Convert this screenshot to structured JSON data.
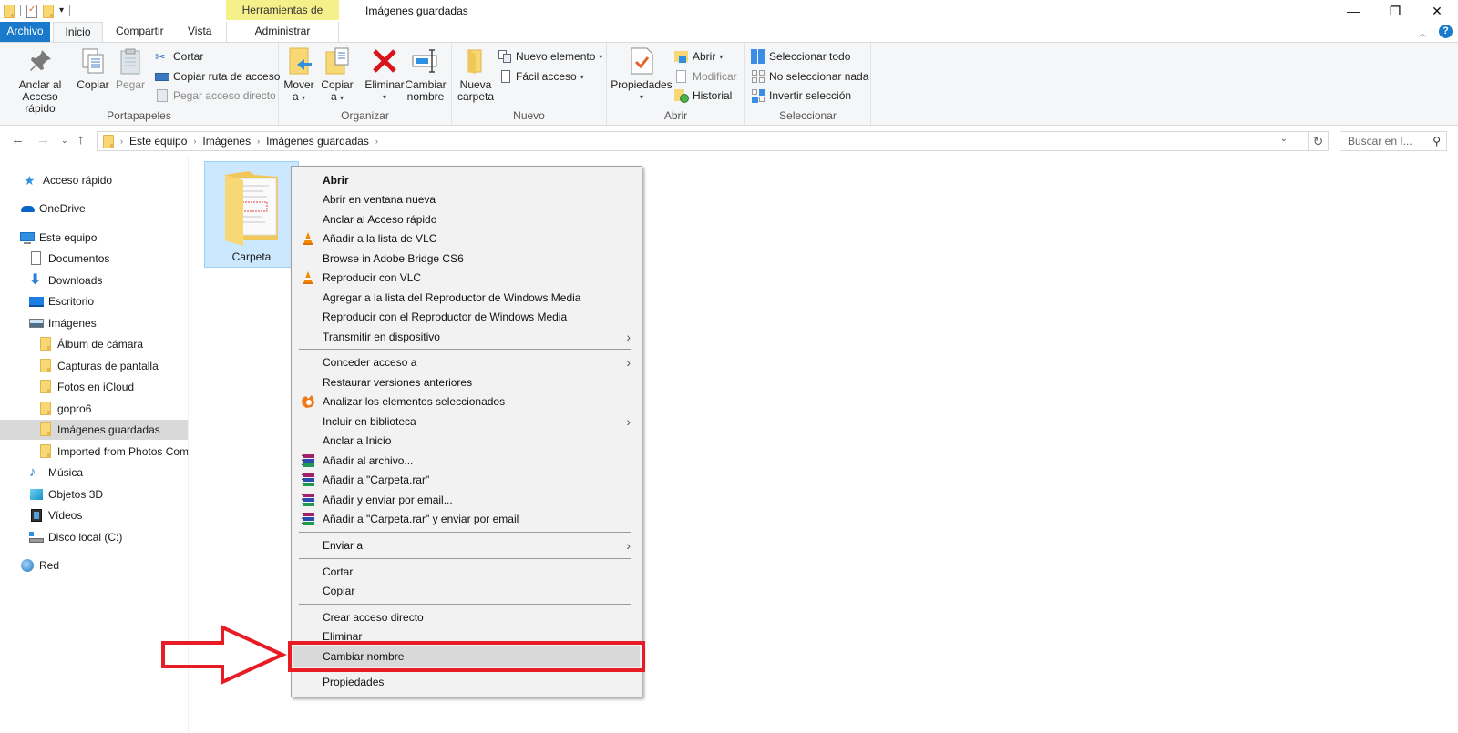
{
  "window": {
    "contextual_tab_group": "Herramientas de imagen",
    "title": "Imágenes guardadas",
    "controls": {
      "minimize": "—",
      "restore": "❐",
      "close": "✕"
    }
  },
  "tabs": {
    "file": "Archivo",
    "home": "Inicio",
    "share": "Compartir",
    "view": "Vista",
    "manage": "Administrar",
    "help": "?"
  },
  "ribbon": {
    "groups": {
      "clipboard": "Portapapeles",
      "organize": "Organizar",
      "new": "Nuevo",
      "open": "Abrir",
      "select": "Seleccionar"
    },
    "pin_quick_access": [
      "Anclar al",
      "Acceso rápido"
    ],
    "copy": "Copiar",
    "paste": "Pegar",
    "cut": "Cortar",
    "copy_path": "Copiar ruta de acceso",
    "paste_shortcut": "Pegar acceso directo",
    "move_to": [
      "Mover",
      "a"
    ],
    "copy_to": [
      "Copiar",
      "a"
    ],
    "delete": "Eliminar",
    "rename": [
      "Cambiar",
      "nombre"
    ],
    "new_folder": [
      "Nueva",
      "carpeta"
    ],
    "new_item": "Nuevo elemento",
    "easy_access": "Fácil acceso",
    "properties": "Propiedades",
    "open": "Abrir",
    "edit": "Modificar",
    "history": "Historial",
    "select_all": "Seleccionar todo",
    "select_none": "No seleccionar nada",
    "invert_selection": "Invertir selección"
  },
  "address": {
    "breadcrumbs": [
      "Este equipo",
      "Imágenes",
      "Imágenes guardadas"
    ],
    "search_placeholder": "Buscar en I..."
  },
  "sidebar": {
    "items": [
      {
        "label": "Acceso rápido",
        "icon": "star-icon"
      },
      {
        "label": "OneDrive",
        "icon": "cloud-icon"
      },
      {
        "label": "Este equipo",
        "icon": "monitor-icon"
      },
      {
        "label": "Documentos",
        "icon": "document-icon"
      },
      {
        "label": "Downloads",
        "icon": "download-arrow-icon"
      },
      {
        "label": "Escritorio",
        "icon": "desktop-icon"
      },
      {
        "label": "Imágenes",
        "icon": "pictures-icon"
      },
      {
        "label": "Álbum de cámara",
        "icon": "folder-icon"
      },
      {
        "label": "Capturas de pantalla",
        "icon": "folder-icon"
      },
      {
        "label": "Fotos en iCloud",
        "icon": "folder-icon"
      },
      {
        "label": "gopro6",
        "icon": "folder-icon"
      },
      {
        "label": "Imágenes guardadas",
        "icon": "folder-icon",
        "selected": true
      },
      {
        "label": "Imported from Photos Com",
        "icon": "folder-icon"
      },
      {
        "label": "Música",
        "icon": "music-icon"
      },
      {
        "label": "Objetos 3D",
        "icon": "cube-icon"
      },
      {
        "label": "Vídeos",
        "icon": "film-icon"
      },
      {
        "label": "Disco local (C:)",
        "icon": "drive-icon"
      },
      {
        "label": "Red",
        "icon": "network-icon"
      }
    ]
  },
  "content": {
    "items": [
      {
        "name": "Carpeta",
        "type": "folder",
        "selected": true
      }
    ]
  },
  "context_menu": {
    "items": [
      {
        "label": "Abrir",
        "bold": true
      },
      {
        "label": "Abrir en ventana nueva"
      },
      {
        "label": "Anclar al Acceso rápido"
      },
      {
        "label": "Añadir a la lista de VLC",
        "icon": "vlc-cone-icon"
      },
      {
        "label": "Browse in Adobe Bridge CS6"
      },
      {
        "label": "Reproducir con VLC",
        "icon": "vlc-cone-icon"
      },
      {
        "label": "Agregar a la lista del Reproductor de Windows Media"
      },
      {
        "label": "Reproducir con el Reproductor de Windows Media"
      },
      {
        "label": "Transmitir en dispositivo",
        "submenu": true
      },
      {
        "label": "Conceder acceso a",
        "submenu": true
      },
      {
        "label": "Restaurar versiones anteriores"
      },
      {
        "label": "Analizar los elementos seleccionados",
        "icon": "avast-icon"
      },
      {
        "label": "Incluir en biblioteca",
        "submenu": true
      },
      {
        "label": "Anclar a Inicio"
      },
      {
        "label": "Añadir al archivo...",
        "icon": "winrar-icon"
      },
      {
        "label": "Añadir a \"Carpeta.rar\"",
        "icon": "winrar-icon"
      },
      {
        "label": "Añadir y enviar por email...",
        "icon": "winrar-icon"
      },
      {
        "label": "Añadir a \"Carpeta.rar\" y enviar por email",
        "icon": "winrar-icon"
      },
      {
        "label": "Enviar a",
        "submenu": true
      },
      {
        "label": "Cortar"
      },
      {
        "label": "Copiar"
      },
      {
        "label": "Crear acceso directo"
      },
      {
        "label": "Eliminar"
      },
      {
        "label": "Cambiar nombre",
        "highlighted": true
      },
      {
        "label": "Propiedades"
      }
    ],
    "submenu_glyph": "›"
  },
  "annotation": {
    "color": "#e81c24",
    "target": "Cambiar nombre"
  },
  "colors": {
    "accent": "#1979ca",
    "ribbon_bg": "#f5f6f7",
    "contextual_tab": "#f6f08a",
    "selection": "#cce8ff",
    "menu_bg": "#f2f2f2",
    "menu_hover": "#d9d9d9"
  }
}
